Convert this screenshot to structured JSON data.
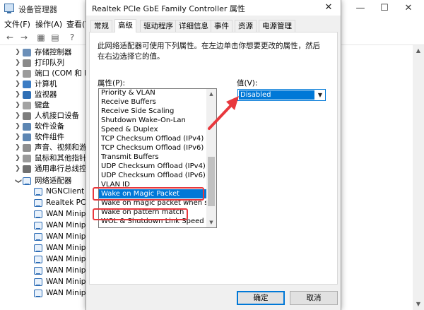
{
  "device_manager": {
    "title": "设备管理器",
    "menus": [
      "文件(F)",
      "操作(A)",
      "查看(V)"
    ],
    "tree": [
      {
        "label": "存储控制器",
        "expanded": false
      },
      {
        "label": "打印队列",
        "expanded": false
      },
      {
        "label": "端口 (COM 和 LPT)",
        "expanded": false
      },
      {
        "label": "计算机",
        "expanded": false
      },
      {
        "label": "监视器",
        "expanded": false
      },
      {
        "label": "键盘",
        "expanded": false
      },
      {
        "label": "人机接口设备",
        "expanded": false
      },
      {
        "label": "软件设备",
        "expanded": false
      },
      {
        "label": "软件组件",
        "expanded": false
      },
      {
        "label": "声音、视频和游戏控制器",
        "expanded": false
      },
      {
        "label": "鼠标和其他指针设备",
        "expanded": false
      },
      {
        "label": "通用串行总线控制器",
        "expanded": false
      },
      {
        "label": "网络适配器",
        "expanded": true
      }
    ],
    "adapters": [
      "NGNClient Adapter",
      "Realtek PCIe",
      "WAN Minipo",
      "WAN Minipo",
      "WAN Minipo",
      "WAN Minipo",
      "WAN Minipo",
      "WAN Minipo",
      "WAN Minipo",
      "WAN Minipo"
    ]
  },
  "dialog": {
    "title": "Realtek PCIe GbE Family Controller 属性",
    "tabs": [
      "常规",
      "高级",
      "驱动程序",
      "详细信息",
      "事件",
      "资源",
      "电源管理"
    ],
    "active_tab": "高级",
    "description": "此网络适配器可使用下列属性。在左边单击你想要更改的属性，然后在右边选择它的值。",
    "property_label": "属性(P):",
    "value_label": "值(V):",
    "properties": [
      "Priority & VLAN",
      "Receive Buffers",
      "Receive Side Scaling",
      "Shutdown Wake-On-Lan",
      "Speed & Duplex",
      "TCP Checksum Offload (IPv4)",
      "TCP Checksum Offload (IPv6)",
      "Transmit Buffers",
      "UDP Checksum Offload (IPv4)",
      "UDP Checksum Offload (IPv6)",
      "VLAN ID",
      "Wake on Magic Packet",
      "Wake on magic packet when syst",
      "Wake on pattern match",
      "WOL & Shutdown Link Speed"
    ],
    "selected_property": "Wake on Magic Packet",
    "value": "Disabled",
    "ok_label": "确定",
    "cancel_label": "取消"
  },
  "colors": {
    "selection": "#0078d7",
    "annotation": "#e8383d"
  }
}
